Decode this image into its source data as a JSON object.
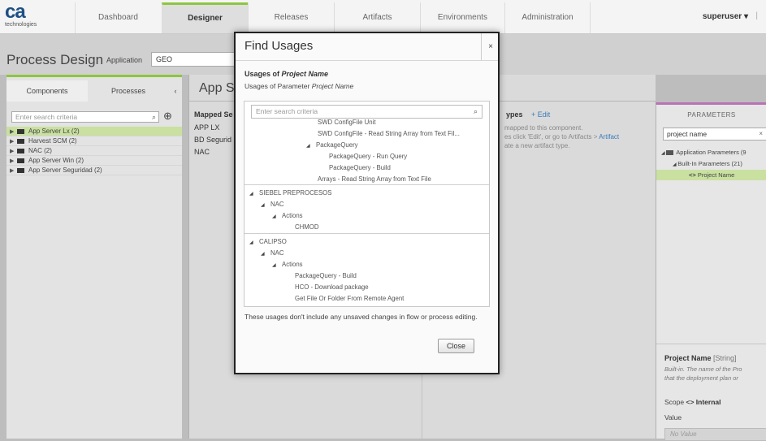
{
  "app": {
    "logo_text": "ca",
    "logo_sub": "technologies",
    "user": "superuser",
    "user_caret": "▾",
    "user_sep": "|"
  },
  "nav": {
    "tabs": [
      {
        "label": "Dashboard"
      },
      {
        "label": "Designer"
      },
      {
        "label": "Releases"
      },
      {
        "label": "Artifacts"
      },
      {
        "label": "Environments"
      },
      {
        "label": "Administration"
      }
    ],
    "active_tab": "Designer"
  },
  "header": {
    "title": "Process Design",
    "app_label": "Application",
    "app_value": "GEO"
  },
  "left_panel": {
    "tabs": [
      "Components",
      "Processes"
    ],
    "collapse": "‹",
    "search_placeholder": "Enter search criteria",
    "add_icon": "⊕",
    "items": [
      {
        "label": "App Server Lx (2)",
        "selected": true
      },
      {
        "label": "Harvest SCM (2)",
        "selected": false
      },
      {
        "label": "NAC (2)",
        "selected": false
      },
      {
        "label": "App Server Win (2)",
        "selected": false
      },
      {
        "label": "App Server Seguridad (2)",
        "selected": false
      }
    ]
  },
  "middle_panel": {
    "title": "App Se",
    "mapped_header": "Mapped Se",
    "mapped_items": [
      "APP LX",
      "BD Segurid",
      "NAC"
    ],
    "types_header": "ypes",
    "edit_link": "+ Edit",
    "info_line1": "mapped to this component.",
    "info_line2_pre": "es click 'Edit', or go to Artifacts > ",
    "info_line2_link": "Artifact",
    "info_line3": "ate a new artifact type."
  },
  "right_panel": {
    "header": "PARAMETERS",
    "search_value": "project name",
    "clear": "×",
    "nodes": [
      {
        "label": "Application Parameters (9"
      },
      {
        "label": "Built-In Parameters (21)"
      },
      {
        "label": "Project Name"
      }
    ],
    "param_name": "Project Name",
    "param_type": "[String]",
    "param_desc_1": "Built-in. The name of the Pro",
    "param_desc_2": "that the deployment plan or",
    "scope_label": "Scope",
    "scope_value": "Internal",
    "value_label": "Value",
    "value_placeholder": "No Value"
  },
  "modal": {
    "title": "Find Usages",
    "close_icon": "×",
    "usages_of": "Usages of",
    "usages_name": "Project Name",
    "param_line_pre": "Usages of Parameter",
    "param_line_name": "Project Name",
    "search_placeholder": "Enter search criteria",
    "tree": [
      {
        "label": "SWD ConfigFile Unit",
        "level": 6,
        "expanded": null
      },
      {
        "label": "SWD ConfigFile - Read String Array from Text Fil...",
        "level": 6,
        "expanded": null
      },
      {
        "label": "PackageQuery",
        "level": 5,
        "expanded": true
      },
      {
        "label": "PackageQuery - Run Query",
        "level": 7,
        "expanded": null
      },
      {
        "label": "PackageQuery - Build",
        "level": 7,
        "expanded": null
      },
      {
        "label": "Arrays - Read String Array from Text File",
        "level": 6,
        "expanded": null
      },
      {
        "label": "SIEBEL PREPROCESOS",
        "level": 0,
        "expanded": true
      },
      {
        "label": "NAC",
        "level": 1,
        "expanded": true
      },
      {
        "label": "Actions",
        "level": 2,
        "expanded": true
      },
      {
        "label": "CHMOD",
        "level": 4,
        "expanded": null
      },
      {
        "label": "CALIPSO",
        "level": 0,
        "expanded": true
      },
      {
        "label": "NAC",
        "level": 1,
        "expanded": true
      },
      {
        "label": "Actions",
        "level": 2,
        "expanded": true
      },
      {
        "label": "PackageQuery - Build",
        "level": 4,
        "expanded": null
      },
      {
        "label": "HCO - Download package",
        "level": 4,
        "expanded": null
      },
      {
        "label": "Get File Or Folder From Remote Agent",
        "level": 4,
        "expanded": null
      }
    ],
    "note": "These usages don't include any unsaved changes in flow or process editing.",
    "close_button": "Close"
  }
}
